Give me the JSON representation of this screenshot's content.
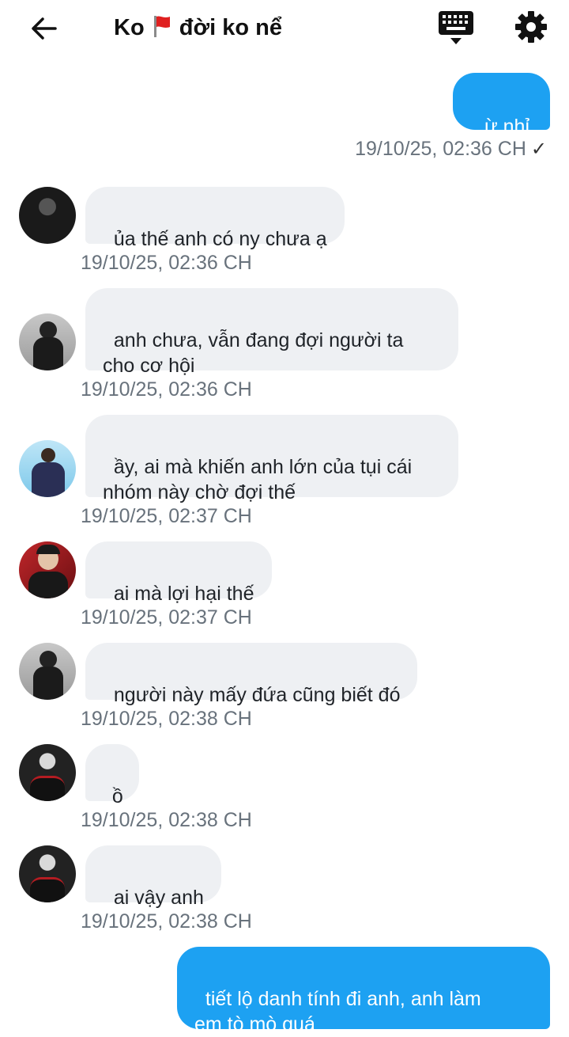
{
  "header": {
    "back_icon": "arrow-left-icon",
    "title_left": "Ko",
    "title_right": "đời ko nể",
    "flag_icon": "red-flag-icon",
    "keyboard_icon": "keyboard-icon",
    "settings_icon": "gear-icon"
  },
  "messages": [
    {
      "text": "ừ nhỉ",
      "time": "19/10/25, 02:36 CH",
      "status": "✓"
    },
    {
      "text": "ủa thế anh có ny chưa ạ",
      "time": "19/10/25, 02:36 CH"
    },
    {
      "text": "anh chưa, vẫn đang đợi người ta\ncho cơ hội",
      "time": "19/10/25, 02:36 CH"
    },
    {
      "text": "ầy, ai mà khiến anh lớn của tụi cái\nnhóm này chờ đợi thế",
      "time": "19/10/25, 02:37 CH"
    },
    {
      "text": "ai mà lợi hại thế",
      "time": "19/10/25, 02:37 CH"
    },
    {
      "text": "người này mấy đứa cũng biết đó",
      "time": "19/10/25, 02:38 CH"
    },
    {
      "text": "ồ",
      "time": "19/10/25, 02:38 CH"
    },
    {
      "text": "ai vậy anh",
      "time": "19/10/25, 02:38 CH"
    },
    {
      "text": "tiết lộ danh tính đi anh, anh làm\nem tò mò quá"
    }
  ],
  "colors": {
    "outgoing_bubble": "#1da1f2",
    "incoming_bubble": "#eef0f3",
    "timestamp": "#68727c"
  }
}
